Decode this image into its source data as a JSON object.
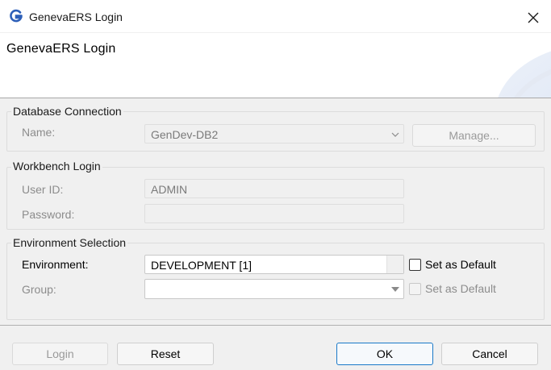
{
  "window": {
    "title": "GenevaERS Login",
    "header_title": "GenevaERS Login"
  },
  "database_connection": {
    "group_label": "Database Connection",
    "name_label": "Name:",
    "name_value": "GenDev-DB2",
    "manage_label": "Manage..."
  },
  "workbench_login": {
    "group_label": "Workbench Login",
    "userid_label": "User ID:",
    "userid_value": "ADMIN",
    "password_label": "Password:",
    "password_value": ""
  },
  "environment_selection": {
    "group_label": "Environment Selection",
    "environment_label": "Environment:",
    "environment_value": "DEVELOPMENT [1]",
    "set_default_label": "Set as Default",
    "group_field_label": "Group:",
    "group_value": "",
    "group_set_default_label": "Set as Default"
  },
  "buttons": {
    "login": "Login",
    "reset": "Reset",
    "ok": "OK",
    "cancel": "Cancel"
  },
  "colors": {
    "accent": "#1979c8",
    "dialog_bg": "#f0f0f0"
  }
}
